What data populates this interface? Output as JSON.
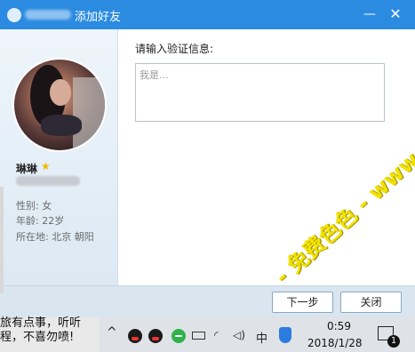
{
  "window": {
    "title": "添加好友",
    "minimize_glyph": "—",
    "close_glyph": "✕"
  },
  "profile": {
    "name": "琳琳",
    "star_icon": "★",
    "gender": "性别: 女",
    "age": "年龄: 22岁",
    "location": "所在地: 北京  朝阳"
  },
  "form": {
    "prompt": "请输入验证信息:",
    "placeholder": "我是..."
  },
  "buttons": {
    "next": "下一步",
    "close": "关闭"
  },
  "background_text": {
    "line1": "旅有点事，听听",
    "line2": "程，不喜勿喷!"
  },
  "taskbar": {
    "chevron": "^",
    "wifi_glyph": "◜",
    "volume_glyph": "◁)",
    "ime": "中",
    "time": "0:59",
    "date": "2018/1/28",
    "notification_count": "1"
  },
  "watermark": "- 免费色色 - www.MFsese.com",
  "colors": {
    "titlebar": "#2a8be0",
    "watermark": "#f2e200"
  }
}
